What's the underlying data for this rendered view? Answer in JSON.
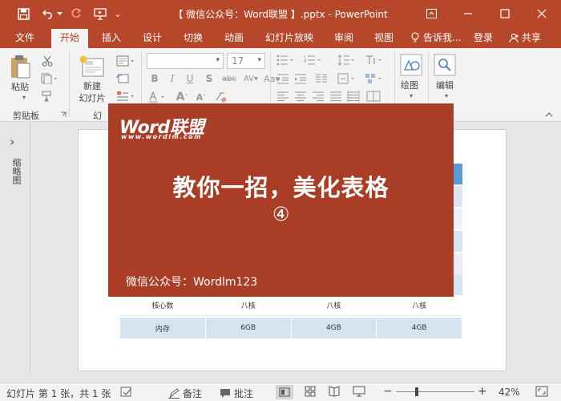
{
  "titlebar": {
    "title": "【 微信公众号：Word联盟 】.pptx - PowerPoint",
    "qat_more": "⌄"
  },
  "tabs": [
    {
      "label": "文件"
    },
    {
      "label": "开始",
      "active": true
    },
    {
      "label": "插入"
    },
    {
      "label": "设计"
    },
    {
      "label": "切换"
    },
    {
      "label": "动画"
    },
    {
      "label": "幻灯片放映"
    },
    {
      "label": "审阅"
    },
    {
      "label": "视图"
    },
    {
      "label": "告诉我..."
    },
    {
      "label": "登录"
    },
    {
      "label": "共享"
    }
  ],
  "ribbon": {
    "paste_label": "粘贴",
    "clipboard_group": "剪贴板",
    "new_slide_label": "新建\n幻灯片",
    "slides_group_partial": "幻",
    "font_size_value": "17",
    "draw_label": "绘图",
    "edit_label": "编辑"
  },
  "thumbpane": {
    "label": "缩略图",
    "expand_glyph": "›"
  },
  "slide": {
    "table_rows": [
      {
        "cells": [
          "核心数",
          "八核",
          "八核",
          "八核"
        ],
        "shade": "#ffffff"
      },
      {
        "cells": [
          "内存",
          "6GB",
          "4GB",
          "4GB"
        ],
        "shade": "#d6e4f2"
      }
    ],
    "header_color": "#5b9bd5"
  },
  "card": {
    "logo": "Word联盟",
    "logo_url": "www.wordlm.com",
    "headline": "教你一招，美化表格",
    "number": "④",
    "wechat": "微信公众号：Wordlm123",
    "bg_color": "#a93d26"
  },
  "statusbar": {
    "slide_info": "幻灯片 第 1 张，共 1 张",
    "notes_label": "备注",
    "comments_label": "批注",
    "zoom": "42%"
  },
  "colors": {
    "accent": "#b7472a",
    "ribbon_bg": "#f3f3f3"
  }
}
